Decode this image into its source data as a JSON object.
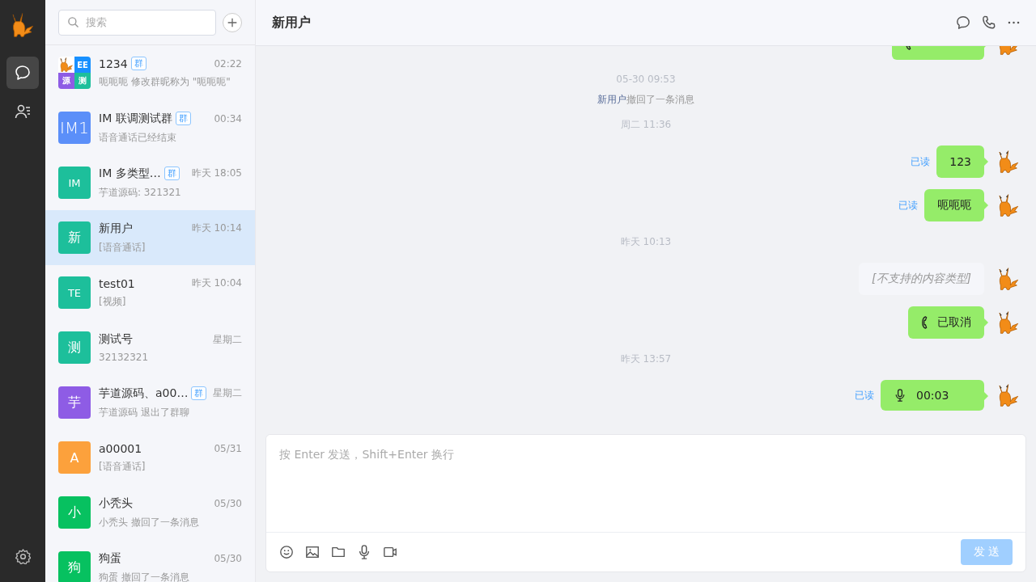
{
  "rail": {
    "items": [
      {
        "selected": true
      },
      {
        "selected": false
      }
    ]
  },
  "conversation_list": {
    "search": {
      "placeholder": "搜索"
    },
    "items": [
      {
        "name": "1234",
        "tag": "群",
        "time": "02:22",
        "preview": "呃呃呃 修改群昵称为 \"呃呃呃\"",
        "selected": false,
        "avatar": {
          "kind": "mosaic",
          "cells": [
            {
              "kind": "mascot"
            },
            {
              "kind": "text",
              "text": "EE",
              "color": "#1890ff"
            },
            {
              "kind": "text",
              "text": "源",
              "color": "#8e5ce5"
            },
            {
              "kind": "text",
              "text": "测",
              "color": "#1dbf9b"
            }
          ]
        }
      },
      {
        "name": "IM 联调测试群",
        "tag": "群",
        "time": "00:34",
        "preview": "语音通话已经结束",
        "selected": false,
        "avatar": {
          "kind": "label",
          "text": "IM1",
          "color": "#5b8ff9"
        }
      },
      {
        "name": "IM 多类型…",
        "tag": "群",
        "time": "昨天 18:05",
        "preview": "芋道源码: 321321",
        "selected": false,
        "avatar": {
          "kind": "text",
          "text": "IM",
          "color": "#1dbf9b"
        }
      },
      {
        "name": "新用户",
        "time": "昨天 10:14",
        "preview": "[语音通话]",
        "selected": true,
        "avatar": {
          "kind": "text",
          "text": "新",
          "color": "#1dbf9b"
        }
      },
      {
        "name": "test01",
        "time": "昨天 10:04",
        "preview": "[视频]",
        "selected": false,
        "avatar": {
          "kind": "text",
          "text": "TE",
          "color": "#1dbf9b"
        }
      },
      {
        "name": "测试号",
        "time": "星期二",
        "preview": "32132321",
        "selected": false,
        "avatar": {
          "kind": "text",
          "text": "测",
          "color": "#1dbf9b"
        }
      },
      {
        "name": "芋道源码、a00…",
        "tag": "群",
        "time": "星期二",
        "preview": "芋道源码 退出了群聊",
        "selected": false,
        "avatar": {
          "kind": "text",
          "text": "芋",
          "color": "#8e5ce5"
        }
      },
      {
        "name": "a00001",
        "time": "05/31",
        "preview": "[语音通话]",
        "selected": false,
        "avatar": {
          "kind": "text",
          "text": "A",
          "color": "#fca13c"
        }
      },
      {
        "name": "小秃头",
        "time": "05/30",
        "preview": "小秃头 撤回了一条消息",
        "selected": false,
        "avatar": {
          "kind": "text",
          "text": "小",
          "color": "#07c160"
        }
      },
      {
        "name": "狗蛋",
        "time": "05/30",
        "preview": "狗蛋 撤回了一条消息",
        "selected": false,
        "avatar": {
          "kind": "text",
          "text": "狗",
          "color": "#07c160"
        }
      }
    ]
  },
  "chat": {
    "title": "新用户",
    "messages": [
      {
        "kind": "call_clipped"
      },
      {
        "kind": "time",
        "text": "05-30 09:53"
      },
      {
        "kind": "recall",
        "user": "新用户",
        "text": "撤回了一条消息"
      },
      {
        "kind": "time",
        "text": "周二 11:36"
      },
      {
        "kind": "text",
        "text": "123",
        "receipt": "已读"
      },
      {
        "kind": "text",
        "text": "呃呃呃",
        "receipt": "已读"
      },
      {
        "kind": "time",
        "text": "昨天 10:13"
      },
      {
        "kind": "unsupported",
        "text": "[不支持的内容类型]"
      },
      {
        "kind": "call",
        "text": "已取消"
      },
      {
        "kind": "time",
        "text": "昨天 13:57"
      },
      {
        "kind": "voice",
        "text": "00:03",
        "receipt": "已读"
      }
    ],
    "input": {
      "placeholder": "按 Enter 发送，Shift+Enter 换行"
    },
    "send_button": {
      "label": "发 送",
      "disabled": true
    }
  }
}
